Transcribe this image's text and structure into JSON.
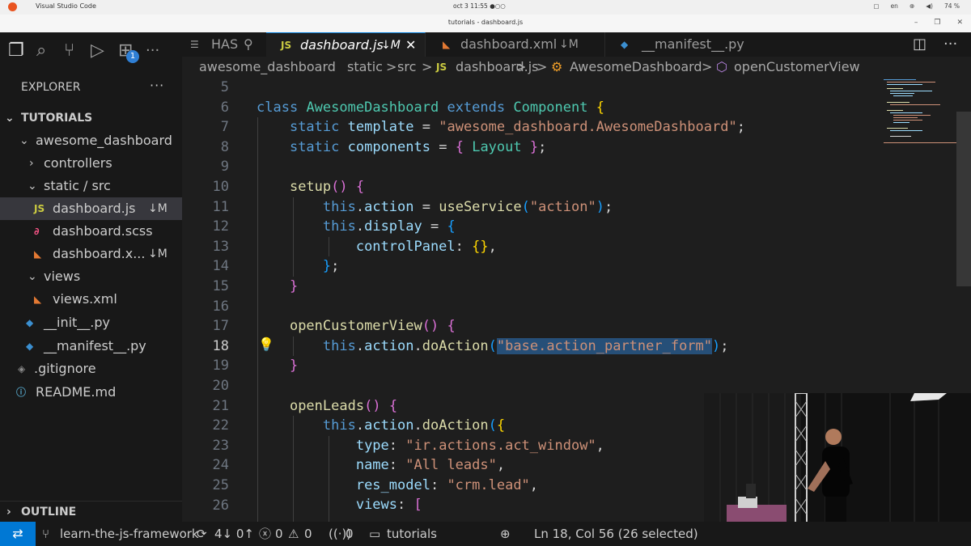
{
  "os_bar": {
    "app_name": "Visual Studio Code",
    "clock": "oct 3  11:55",
    "lang": "en",
    "battery": "74 %"
  },
  "window": {
    "title": "tutorials - dashboard.js"
  },
  "activity_bar": {
    "extensions_badge": "1"
  },
  "explorer": {
    "title": "EXPLORER",
    "more": "···",
    "root": "TUTORIALS",
    "items": [
      {
        "label": "awesome_dashboard",
        "chevron": "⌄"
      },
      {
        "label": "controllers",
        "chevron": "›"
      },
      {
        "label": "static / src",
        "chevron": "⌄"
      },
      {
        "label": "dashboard.js",
        "icon": "JS",
        "mod": "↓M"
      },
      {
        "label": "dashboard.scss",
        "icon": "scss-icon"
      },
      {
        "label": "dashboard.x...",
        "icon": "rss-icon",
        "mod": "↓M"
      },
      {
        "label": "views",
        "chevron": "⌄"
      },
      {
        "label": "views.xml",
        "icon": "rss-icon"
      },
      {
        "label": "__init__.py",
        "icon": "python-icon"
      },
      {
        "label": "__manifest__.py",
        "icon": "python-icon"
      },
      {
        "label": ".gitignore",
        "icon": "git-icon"
      },
      {
        "label": "README.md",
        "icon": "info-icon"
      }
    ],
    "outline": "OUTLINE"
  },
  "tabs": [
    {
      "label": "HAS"
    },
    {
      "label": "dashboard.js",
      "icon": "JS",
      "mod": "↓M",
      "active": true
    },
    {
      "label": "dashboard.xml",
      "mod": "↓M"
    },
    {
      "label": "__manifest__.py"
    }
  ],
  "breadcrumb": {
    "parts": [
      "awesome_dashboard",
      ">",
      "static",
      ">",
      "src",
      ">",
      "JS",
      "dashboard.js",
      ">",
      "AwesomeDashboard",
      ">",
      "openCustomerView"
    ]
  },
  "editor": {
    "line_numbers": [
      "5",
      "6",
      "7",
      "8",
      "9",
      "10",
      "11",
      "12",
      "13",
      "14",
      "15",
      "16",
      "17",
      "18",
      "19",
      "20",
      "21",
      "22",
      "23",
      "24",
      "25",
      "26"
    ],
    "current_line": "18"
  },
  "status": {
    "branch": "learn-the-js-framework",
    "sync": "4↓ 0↑",
    "errors": "0",
    "warnings": "0",
    "ports": "0",
    "folder": "tutorials",
    "cursor": "Ln 18, Col 56 (26 selected)"
  }
}
